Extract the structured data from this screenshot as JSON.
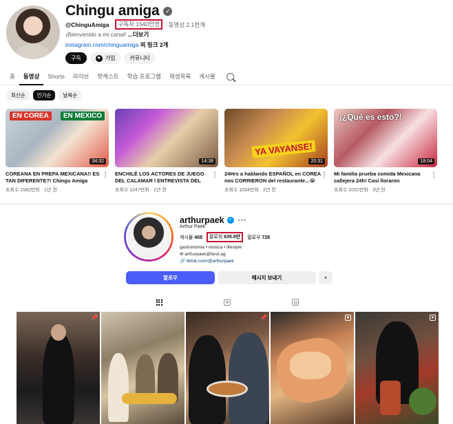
{
  "youtube": {
    "channel_name": "Chingu amiga",
    "handle": "@ChinguAmiga",
    "separator": "·",
    "subscribers": "구독자 1540만명",
    "video_count": "동영상 2.1천개",
    "description": "¡Bienvenido a mi canal!",
    "more": "...더보기",
    "link_url": "instagram.com/chinguamiga",
    "link_more": "외 링크 2개",
    "buttons": {
      "subscribe": "구독",
      "join": "가입",
      "community": "커뮤니티"
    },
    "tabs": [
      "홈",
      "동영상",
      "Shorts",
      "라이브",
      "팟캐스트",
      "학습 프로그램",
      "재생목록",
      "게시물"
    ],
    "active_tab": "동영상",
    "chips": [
      "최신순",
      "인기순",
      "날짜순"
    ],
    "active_chip": "인기순",
    "videos": [
      {
        "title": "COREANA EN PREPA MEXICANA!! ES TAN DIFERENTE?! Chingu Amiga",
        "meta": "조회수 1582만회 · 1년 전",
        "duration": "34:32",
        "caption_a": "EN COREA",
        "caption_b": "EN MEXICO"
      },
      {
        "title": "ENCHILÉ LOS ACTORES DE JUEGO DEL CALAMAR l ENTREVISTA DEL SERIE,...",
        "meta": "조회수 1247만회 · 1년 전",
        "duration": "14:38"
      },
      {
        "title": "24Hrs a hablando ESPAÑOL en COREA nos CORRIERON del restaurante...😭",
        "meta": "조회수 1034만회 · 2년 전",
        "duration": "20:31",
        "caption_a": "YA VAYANSE!"
      },
      {
        "title": "Mi familia prueba comida Mexicana callejera 24h! Casi lloraron",
        "meta": "조회수 1031만회 · 3년 전",
        "duration": "18:04",
        "caption_a": "¡¿Qué es esto?!"
      }
    ]
  },
  "instagram": {
    "username": "arthurpaek",
    "more": "···",
    "full_name": "Arthur Paek",
    "posts_label": "게시물",
    "posts_count": "408",
    "followers_label": "팔로워",
    "followers_count": "635.8만",
    "following_label": "팔로우",
    "following_count": "728",
    "bio_line1": "gastronomia • música • lifestyle",
    "bio_line2": "arthurpaek@farol.ag",
    "bio_link": "tiktok.com/@arthurpaek",
    "follow_button": "팔로우",
    "message_button": "메시지 보내기",
    "add_user": "+"
  },
  "colors": {
    "highlight_box": "#c8102e",
    "yt_link": "#065fd4",
    "ig_follow": "#4a5df9",
    "ig_verified": "#0095f6"
  },
  "icons": [
    "verified-icon",
    "star-icon",
    "search-icon",
    "grid-icon",
    "reels-icon",
    "tagged-icon",
    "pin-icon",
    "reel-badge-icon",
    "add-user-icon",
    "kebab-icon"
  ]
}
